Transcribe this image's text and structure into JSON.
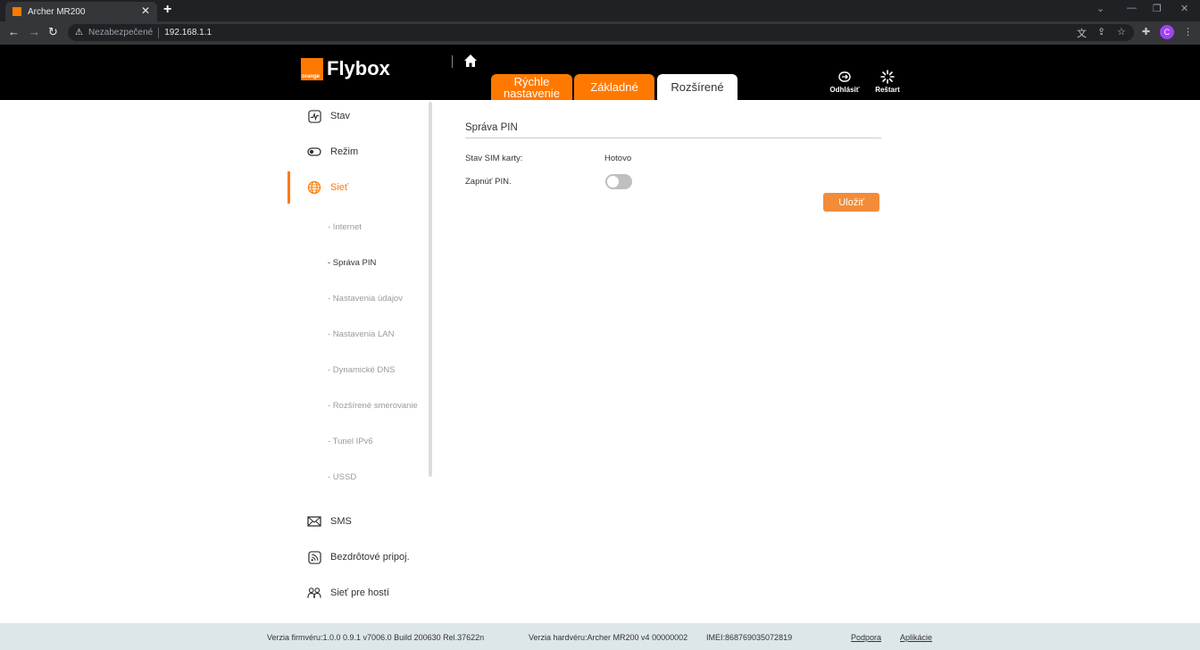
{
  "browser": {
    "tab_title": "Archer MR200",
    "tab_close": "✕",
    "new_tab": "+",
    "not_secure_label": "Nezabezpečené",
    "url": "192.168.1.1",
    "profile_initial": "C"
  },
  "header": {
    "logo_small": "orange",
    "logo_text": "Flybox",
    "tabs": [
      {
        "label": "Rýchle nastavenie"
      },
      {
        "label": "Základné"
      },
      {
        "label": "Rozšírené"
      }
    ],
    "logout_label": "Odhlásiť",
    "restart_label": "Reštart"
  },
  "sidebar": {
    "items": [
      {
        "label": "Stav"
      },
      {
        "label": "Režim"
      },
      {
        "label": "Sieť"
      },
      {
        "label": "SMS"
      },
      {
        "label": "Bezdrôtové pripoj."
      },
      {
        "label": "Sieť pre hostí"
      }
    ],
    "subitems": [
      {
        "label": "- Internet"
      },
      {
        "label": "- Správa PIN"
      },
      {
        "label": "- Nastavenia údajov"
      },
      {
        "label": "- Nastavenia LAN"
      },
      {
        "label": "- Dynamické DNS"
      },
      {
        "label": "- Rozšírené smerovanie"
      },
      {
        "label": "- Tunel IPv6"
      },
      {
        "label": "- USSD"
      }
    ]
  },
  "content": {
    "title": "Správa PIN",
    "sim_status_label": "Stav SIM karty:",
    "sim_status_value": "Hotovo",
    "pin_enable_label": "Zapnúť PIN.",
    "pin_enabled": false,
    "save_label": "Uložiť"
  },
  "footer": {
    "firmware": "Verzia firmvéru:1.0.0 0.9.1 v7006.0 Build 200630 Rel.37622n",
    "hardware": "Verzia hardvéru:Archer MR200 v4 00000002",
    "imei": "IMEI:868769035072819",
    "support": "Podpora",
    "apps": "Aplikácie"
  },
  "colors": {
    "accent": "#ff7900",
    "save_button": "#f28c38",
    "header_bg": "#000000",
    "footer_bg": "#dde7e9"
  }
}
